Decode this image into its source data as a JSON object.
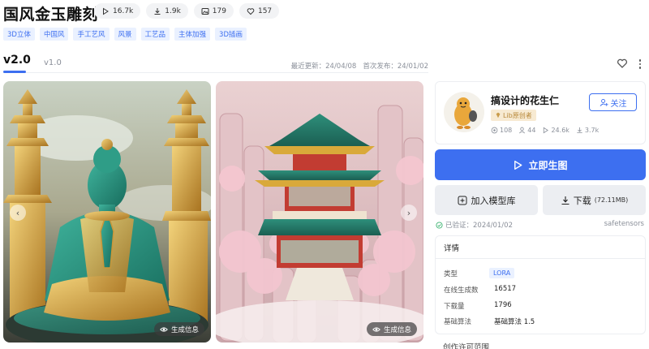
{
  "title": "国风金玉雕刻",
  "stats": [
    {
      "icon": "play-icon",
      "value": "16.7k"
    },
    {
      "icon": "download-icon",
      "value": "1.9k"
    },
    {
      "icon": "image-icon",
      "value": "179"
    },
    {
      "icon": "heart-icon",
      "value": "157"
    }
  ],
  "tags": [
    "3D立体",
    "中国风",
    "手工艺风",
    "风景",
    "工艺品",
    "主体加强",
    "3D插画"
  ],
  "versions": {
    "active": "v2.0",
    "other": "v1.0"
  },
  "dates": {
    "updated": "最近更新：24/04/08",
    "published": "首次发布：24/01/02"
  },
  "gallery": {
    "gen_info_label": "生成信息",
    "prev": "‹",
    "next": "›"
  },
  "author": {
    "name": "搞设计的花生仁",
    "badge": "Lib原创者",
    "follow_label": "关注",
    "stats": [
      {
        "icon": "models-icon",
        "value": "108"
      },
      {
        "icon": "user-icon",
        "value": "44"
      },
      {
        "icon": "play-icon",
        "value": "24.6k"
      },
      {
        "icon": "download-icon",
        "value": "3.7k"
      }
    ]
  },
  "actions": {
    "run": "立即生图",
    "add": "加入模型库",
    "download": "下载",
    "download_size": "(72.11MB)"
  },
  "verified": "已验证：2024/01/02",
  "format": "safetensors",
  "details": {
    "heading": "详情",
    "type_label": "类型",
    "type_value": "LORA",
    "online_label": "在线生成数",
    "online_value": "16517",
    "downloads_label": "下载量",
    "downloads_value": "1796",
    "algo_label": "基础算法",
    "algo_value": "基础算法 1.5"
  },
  "license_heading": "创作许可范围",
  "colors": {
    "accent": "#3d6ff0",
    "tag_bg": "#eaf1ff",
    "jade": "#1f8f7a",
    "gold": "#d9a93a",
    "blossom": "#e9b9c3"
  }
}
